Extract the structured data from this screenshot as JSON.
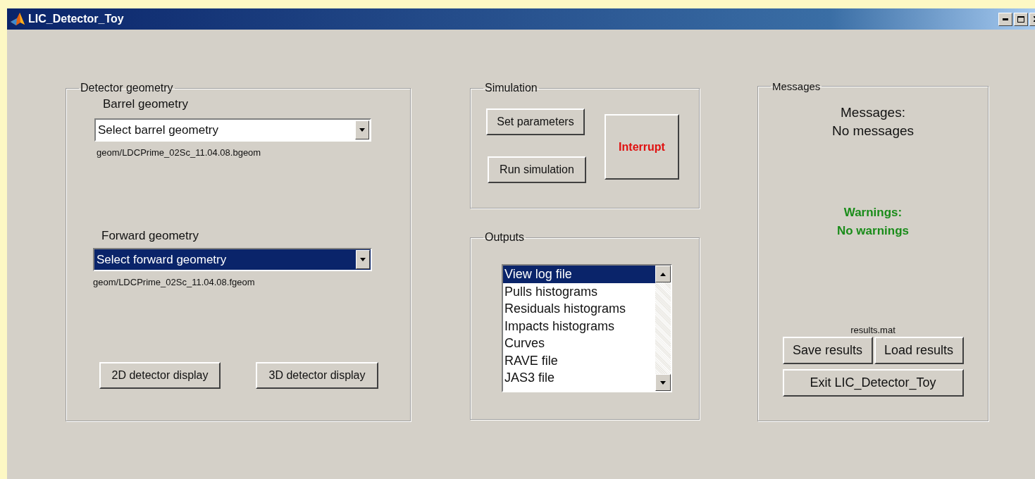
{
  "window": {
    "title": "LIC_Detector_Toy"
  },
  "detector_geometry": {
    "title": "Detector geometry",
    "selectors": [
      {
        "label": "Barrel geometry",
        "value": "Select barrel geometry",
        "focused": false,
        "path": "geom/LDCPrime_02Sc_11.04.08.bgeom"
      },
      {
        "label": "Forward geometry",
        "value": "Select forward geometry",
        "focused": true,
        "path": "geom/LDCPrime_02Sc_11.04.08.fgeom"
      }
    ],
    "buttons": [
      "2D detector display",
      "3D detector display"
    ]
  },
  "simulation": {
    "title": "Simulation",
    "buttons": [
      {
        "label": "Set parameters",
        "kind": "normal"
      },
      {
        "label": "Run simulation",
        "kind": "normal"
      },
      {
        "label": "Interrupt",
        "kind": "alert"
      }
    ]
  },
  "outputs": {
    "title": "Outputs",
    "items": [
      {
        "label": "View log file",
        "selected": true
      },
      {
        "label": "Pulls histograms",
        "selected": false
      },
      {
        "label": "Residuals histograms",
        "selected": false
      },
      {
        "label": "Impacts histograms",
        "selected": false
      },
      {
        "label": "Curves",
        "selected": false
      },
      {
        "label": "RAVE file",
        "selected": false
      },
      {
        "label": "JAS3 file",
        "selected": false
      }
    ]
  },
  "messages": {
    "title": "Messages",
    "blocks": [
      {
        "kind": "info",
        "lines": [
          "Messages:",
          "No messages"
        ]
      },
      {
        "kind": "ok",
        "lines": [
          "Warnings:",
          "No warnings"
        ]
      }
    ],
    "file": "results.mat",
    "buttons": [
      "Save results",
      "Load results"
    ],
    "exit_button": "Exit LIC_Detector_Toy"
  }
}
